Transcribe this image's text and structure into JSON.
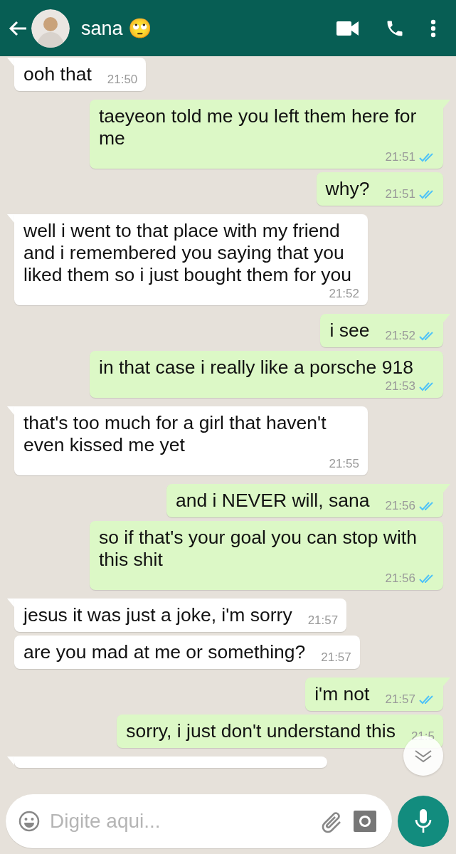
{
  "header": {
    "contact_name": "sana 🙄"
  },
  "messages": [
    {
      "kind": "incoming",
      "text": "ooh that",
      "time": "21:50"
    },
    {
      "kind": "outgoing",
      "text": "taeyeon told me you left them here for me",
      "time": "21:51",
      "read": true
    },
    {
      "kind": "outgoing",
      "text": "why?",
      "time": "21:51",
      "read": true
    },
    {
      "kind": "incoming",
      "text": "well i went to that place with my friend and i remembered you saying that you liked them so i just bought them for you",
      "time": "21:52"
    },
    {
      "kind": "outgoing",
      "text": "i see",
      "time": "21:52",
      "read": true
    },
    {
      "kind": "outgoing",
      "text": "in that case i really like a porsche 918",
      "time": "21:53",
      "read": true
    },
    {
      "kind": "incoming",
      "text": "that's too much for a girl that haven't even kissed me yet",
      "time": "21:55"
    },
    {
      "kind": "outgoing",
      "text": "and i NEVER will, sana",
      "time": "21:56",
      "read": true
    },
    {
      "kind": "outgoing",
      "text": "so if that's your goal you can stop with this shit",
      "time": "21:56",
      "read": true
    },
    {
      "kind": "incoming",
      "text": "jesus it was just a joke, i'm sorry",
      "time": "21:57"
    },
    {
      "kind": "incoming",
      "text": "are you mad at me or something?",
      "time": "21:57"
    },
    {
      "kind": "outgoing",
      "text": "i'm not",
      "time": "21:57",
      "read": true
    },
    {
      "kind": "outgoing",
      "text": "sorry, i just don't understand this",
      "time": "21:5"
    },
    {
      "kind": "incoming-cut"
    }
  ],
  "composer": {
    "placeholder": "Digite aqui..."
  }
}
